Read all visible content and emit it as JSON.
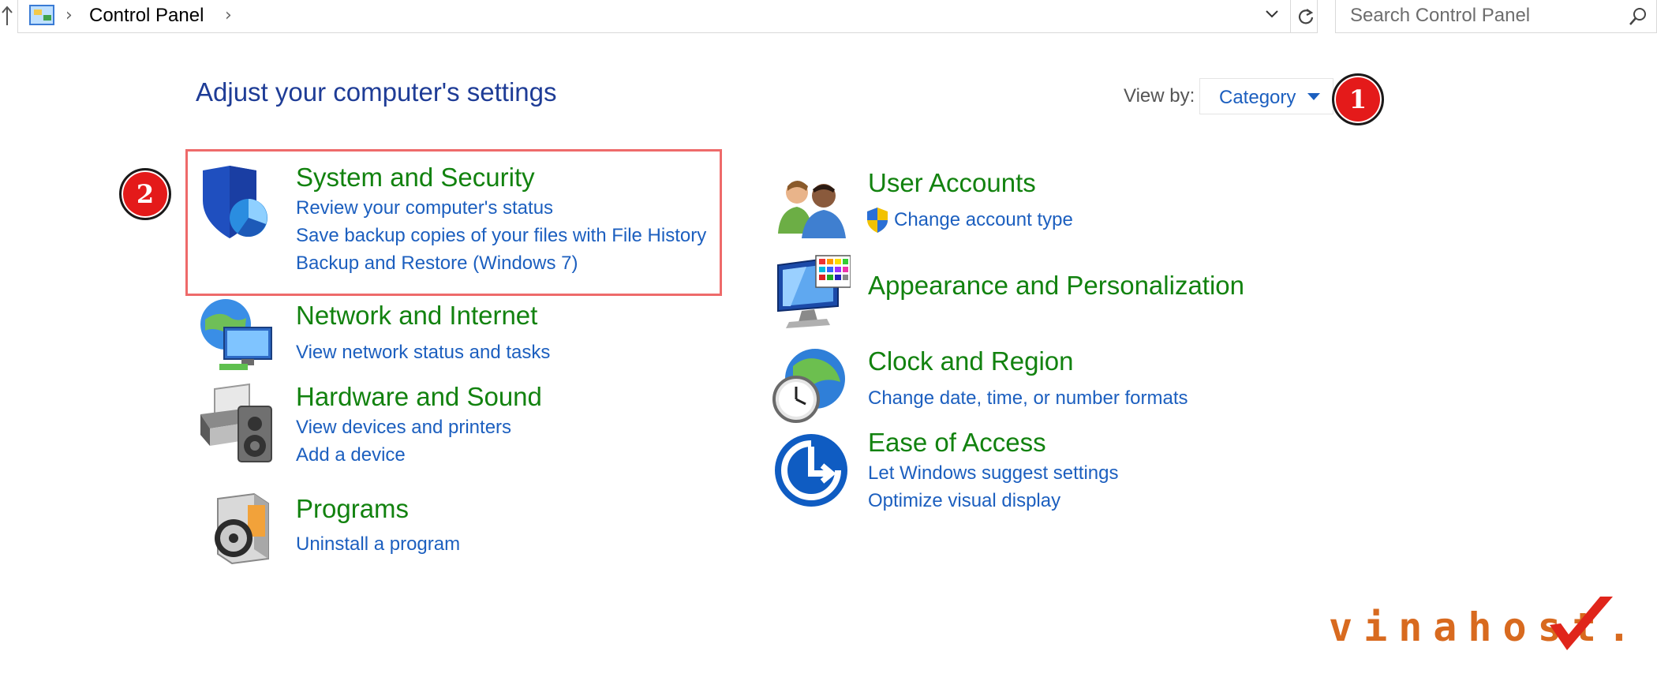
{
  "address_bar": {
    "breadcrumb": "Control Panel",
    "search_placeholder": "Search Control Panel"
  },
  "header": {
    "title": "Adjust your computer's settings",
    "view_by_label": "View by:",
    "view_by_value": "Category"
  },
  "annotations": {
    "badge_1": "1",
    "badge_2": "2"
  },
  "categories": {
    "system_security": {
      "title": "System and Security",
      "links": [
        "Review your computer's status",
        "Save backup copies of your files with File History",
        "Backup and Restore (Windows 7)"
      ]
    },
    "network": {
      "title": "Network and Internet",
      "links": [
        "View network status and tasks"
      ]
    },
    "hardware": {
      "title": "Hardware and Sound",
      "links": [
        "View devices and printers",
        "Add a device"
      ]
    },
    "programs": {
      "title": "Programs",
      "links": [
        "Uninstall a program"
      ]
    },
    "user_accounts": {
      "title": "User Accounts",
      "links": [
        "Change account type"
      ]
    },
    "appearance": {
      "title": "Appearance and Personalization"
    },
    "clock": {
      "title": "Clock and Region",
      "links": [
        "Change date, time, or number formats"
      ]
    },
    "ease": {
      "title": "Ease of Access",
      "links": [
        "Let Windows suggest settings",
        "Optimize visual display"
      ]
    }
  },
  "watermark": {
    "text": "vinahost."
  },
  "colors": {
    "title_blue": "#1e3c96",
    "category_green": "#12820f",
    "link_blue": "#1c5fbf",
    "badge_red": "#e41a1a",
    "highlight_border": "#ee6a6a",
    "watermark_orange": "#d86a1f"
  },
  "icons": {
    "address_bar": [
      "up-arrow-icon",
      "control-panel-icon",
      "chevron-right-icon",
      "chevron-down-icon",
      "refresh-icon",
      "search-icon"
    ],
    "categories": [
      "shield-icon",
      "network-globe-icon",
      "printer-speaker-icon",
      "programs-disc-icon",
      "users-icon",
      "uac-shield-icon",
      "monitor-palette-icon",
      "clock-globe-icon",
      "ease-of-access-icon"
    ]
  }
}
